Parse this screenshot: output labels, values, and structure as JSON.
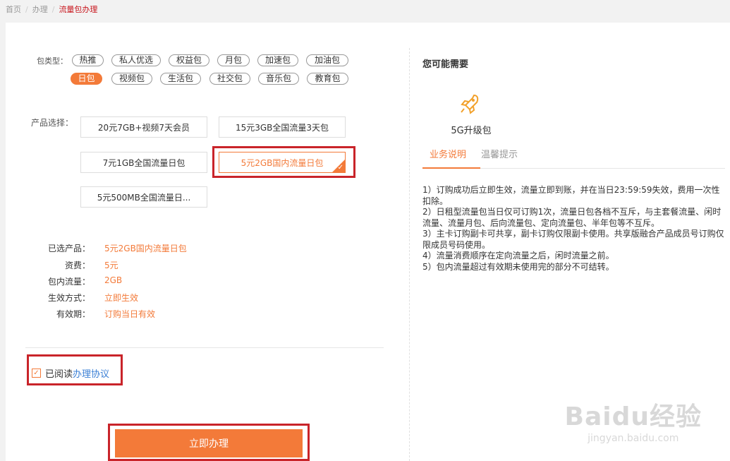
{
  "breadcrumb": {
    "home": "首页",
    "section": "办理",
    "current": "流量包办理"
  },
  "package_types": {
    "label": "包类型：",
    "items": [
      "热推",
      "私人优选",
      "权益包",
      "月包",
      "加速包",
      "加油包",
      "日包",
      "视频包",
      "生活包",
      "社交包",
      "音乐包",
      "教育包"
    ],
    "selected": "日包"
  },
  "products": {
    "label": "产品选择：",
    "items": [
      "20元7GB+视频7天会员",
      "15元3GB全国流量3天包",
      "7元1GB全国流量日包",
      "5元2GB国内流量日包",
      "5元500MB全国流量日..."
    ],
    "selected": "5元2GB国内流量日包"
  },
  "summary": {
    "rows": [
      {
        "key": "已选产品：",
        "value": "5元2GB国内流量日包"
      },
      {
        "key": "资费：",
        "value": "5元"
      },
      {
        "key": "包内流量：",
        "value": "2GB"
      },
      {
        "key": "生效方式：",
        "value": "立即生效"
      },
      {
        "key": "有效期：",
        "value": "订购当日有效"
      }
    ]
  },
  "agreement": {
    "prefix": "已阅读",
    "link": "办理协议",
    "checked": true
  },
  "submit_label": "立即办理",
  "sidebar": {
    "title": "您可能需要",
    "package_name": "5G升级包",
    "package_icon": "rocket-icon",
    "tabs": [
      "业务说明",
      "温馨提示"
    ],
    "notes": [
      "1）订购成功后立即生效，流量立即到账，并在当日23:59:59失效，费用一次性扣除。",
      "2）日租型流量包当日仅可订购1次，流量日包各档不互斥，与主套餐流量、闲时流量、流量月包、后向流量包、定向流量包、半年包等不互斥。",
      "3）主卡订购副卡可共享，副卡订购仅限副卡使用。共享版融合产品成员号订购仅限成员号码使用。",
      "4）流量消费顺序在定向流量之后，闲时流量之前。",
      "5）包内流量超过有效期未使用完的部分不可结转。"
    ]
  },
  "watermark": {
    "brand": "Baidu经验",
    "url": "jingyan.baidu.com"
  },
  "colors": {
    "accent": "#f37a39",
    "highlight_box": "#c9242a",
    "link": "#3a7fd5"
  }
}
